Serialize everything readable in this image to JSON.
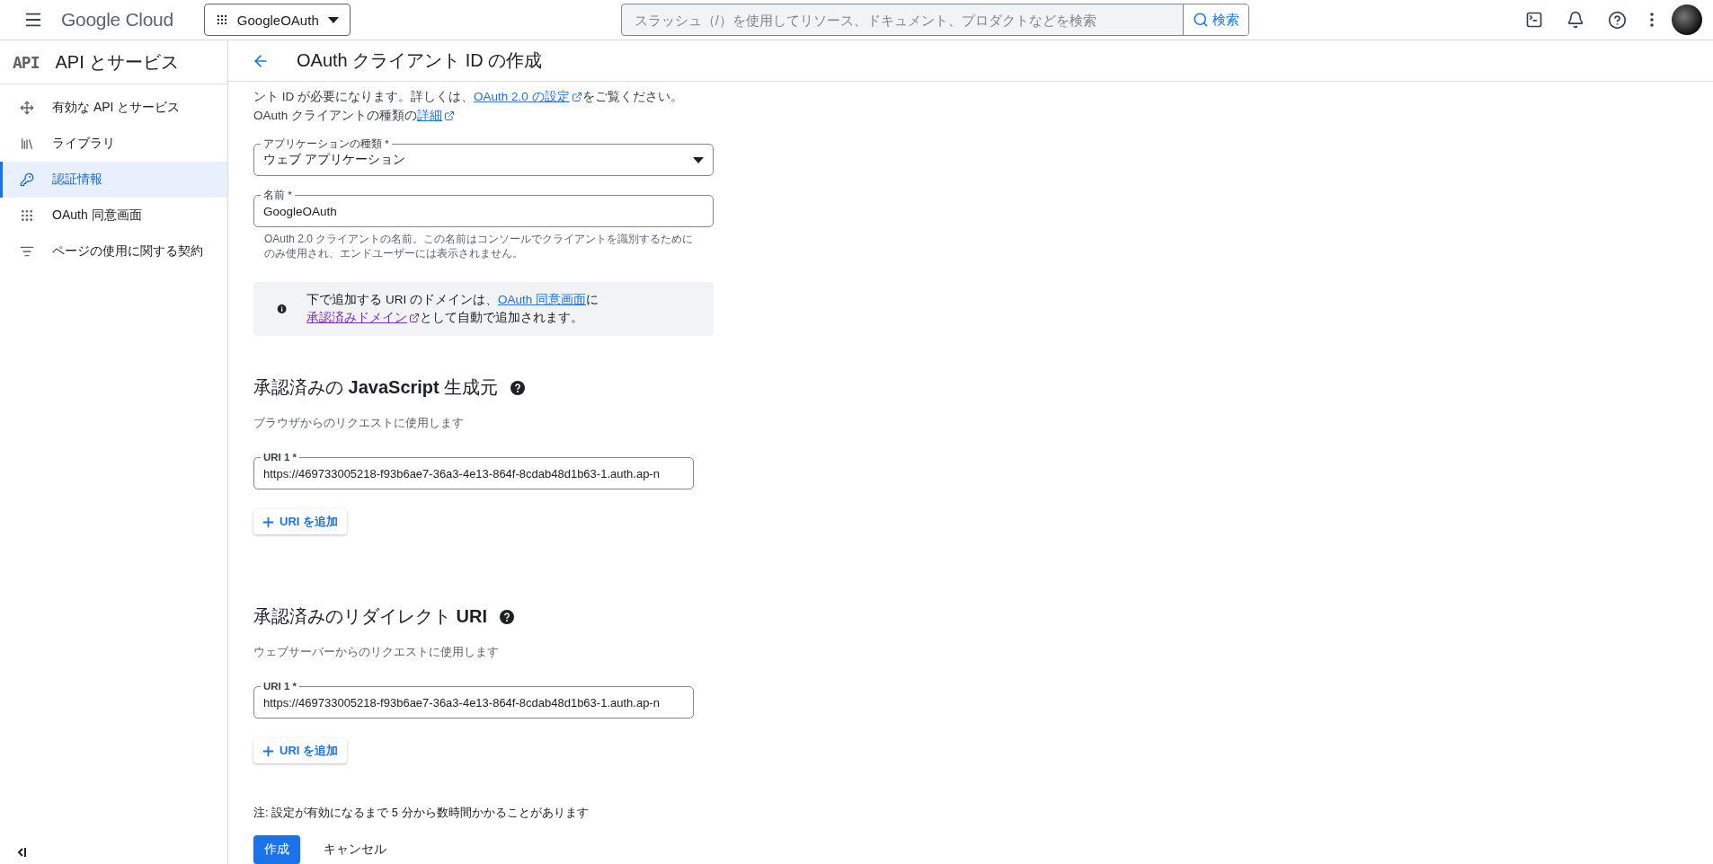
{
  "header": {
    "logo": "Google Cloud",
    "project": "GoogleOAuth",
    "search": {
      "placeholder": "スラッシュ（/）を使用してリソース、ドキュメント、プロダクトなどを検索",
      "button": "検索"
    }
  },
  "sidebar": {
    "api_logo": "API",
    "title": "API とサービス",
    "items": [
      {
        "label": "有効な API とサービス",
        "selected": false
      },
      {
        "label": "ライブラリ",
        "selected": false
      },
      {
        "label": "認証情報",
        "selected": true
      },
      {
        "label": "OAuth 同意画面",
        "selected": false
      },
      {
        "label": "ページの使用に関する契約",
        "selected": false
      }
    ]
  },
  "page": {
    "title": "OAuth クライアント ID の作成",
    "intro": [
      {
        "kind": "text",
        "text": "ント ID が必要になります。詳しくは、"
      },
      {
        "kind": "link",
        "text": "OAuth 2.0 の設定",
        "external": true
      },
      {
        "kind": "text",
        "text": "をご覧ください。 OAuth クライアントの種類の"
      },
      {
        "kind": "link",
        "text": "詳細",
        "external": true
      }
    ],
    "app_type": {
      "label": "アプリケーションの種類 *",
      "value": "ウェブ アプリケーション"
    },
    "name": {
      "label": "名前 *",
      "value": "GoogleOAuth",
      "hint": "OAuth 2.0 クライアントの名前。この名前はコンソールでクライアントを識別するためにのみ使用され、エンドユーザーには表示されません。"
    },
    "notice": [
      {
        "kind": "text",
        "text": "下で追加する URI のドメインは、"
      },
      {
        "kind": "link",
        "text": "OAuth 同意画面",
        "external": false
      },
      {
        "kind": "text",
        "text": "に"
      },
      {
        "kind": "visited_link",
        "text": "承認済みドメイン",
        "external": true
      },
      {
        "kind": "text",
        "text": "として自動で追加されます。"
      }
    ],
    "sections": [
      {
        "title": "承認済みの **JavaScript** 生成元",
        "subtitle": "ブラウザからのリクエストに使用します",
        "uris": [
          {
            "label": "URI 1 *",
            "value": "https://469733005218-f93b6ae7-36a3-4e13-864f-8cdab48d1b63-1.auth.ap-n"
          }
        ],
        "add_button": "URI を追加"
      },
      {
        "title": "承認済みのリダイレクト **URI**",
        "subtitle": "ウェブサーバーからのリクエストに使用します",
        "uris": [
          {
            "label": "URI 1 *",
            "value": "https://469733005218-f93b6ae7-36a3-4e13-864f-8cdab48d1b63-1.auth.ap-n"
          }
        ],
        "add_button": "URI を追加"
      }
    ],
    "note": "注: 設定が有効になるまで 5 分から数時間かかることがあります",
    "buttons": [
      {
        "kind": "primary",
        "label": "作成"
      },
      {
        "kind": "text",
        "label": "キャンセル"
      }
    ]
  }
}
